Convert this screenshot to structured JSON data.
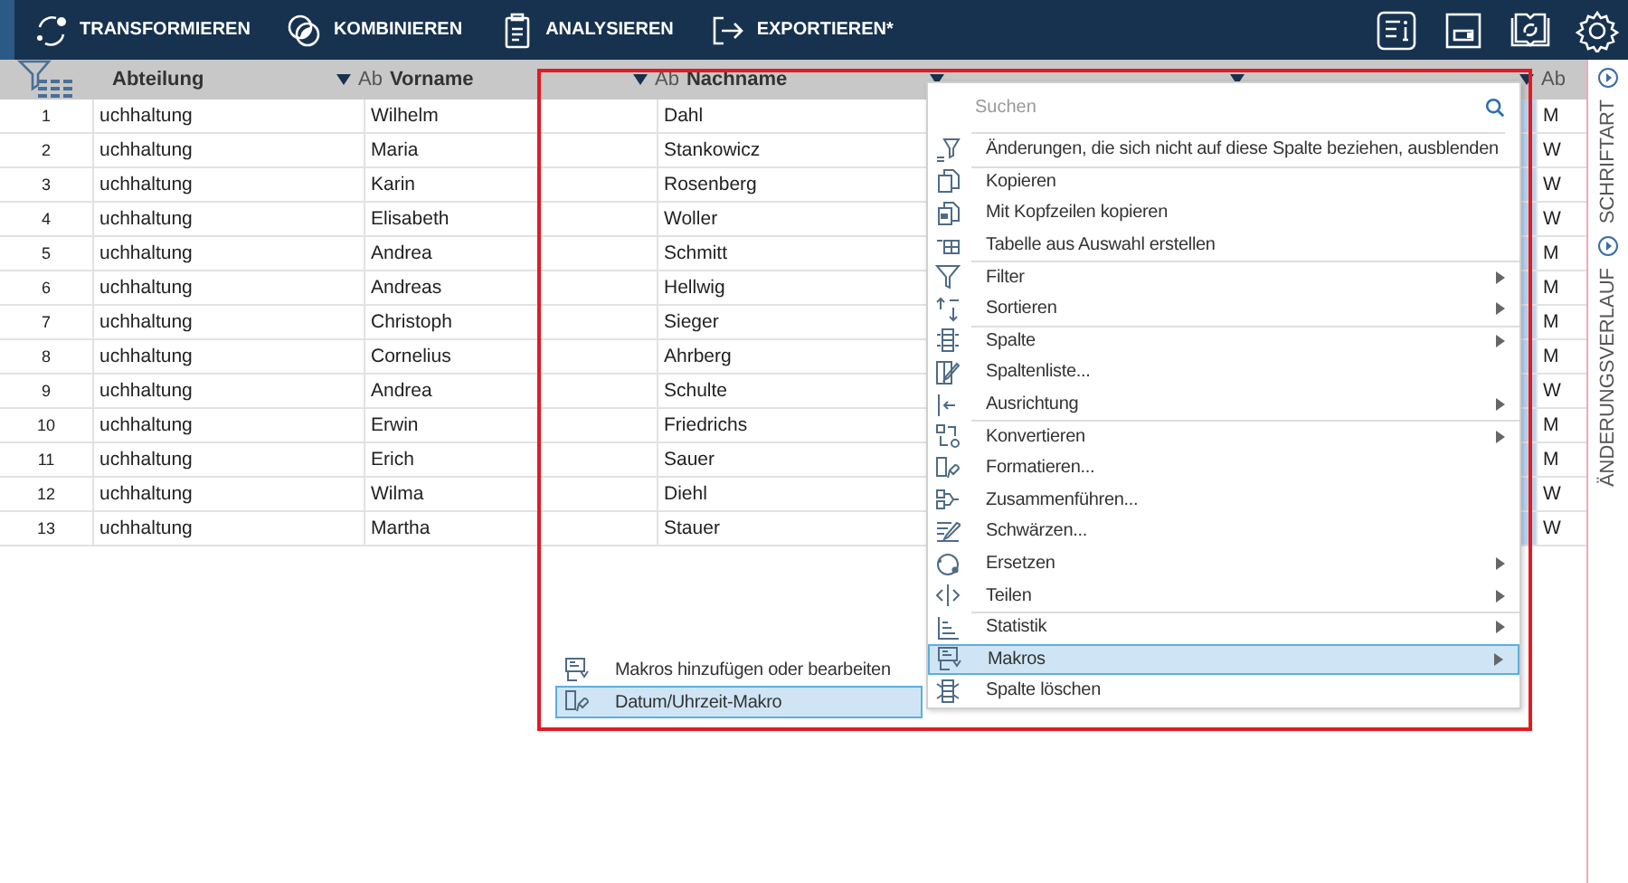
{
  "toolbar": {
    "items": [
      {
        "label": "TRANSFORMIEREN"
      },
      {
        "label": "KOMBINIEREN"
      },
      {
        "label": "ANALYSIEREN"
      },
      {
        "label": "EXPORTIEREN*"
      }
    ]
  },
  "table": {
    "columns": [
      {
        "name": "Abteilung",
        "kind": "data"
      },
      {
        "name": "Vorname",
        "type": "Ab",
        "kind": "data"
      },
      {
        "name": "Nachname",
        "type": "Ab",
        "kind": "data"
      },
      {
        "kind": "covered"
      },
      {
        "kind": "selected"
      },
      {
        "type": "Ab",
        "kind": "data"
      }
    ],
    "rows": [
      {
        "number": "1",
        "cells": [
          "uchhaltung",
          "Wilhelm",
          "Dahl",
          "M"
        ]
      },
      {
        "number": "2",
        "cells": [
          "uchhaltung",
          "Maria",
          "Stankowicz",
          "W"
        ]
      },
      {
        "number": "3",
        "cells": [
          "uchhaltung",
          "Karin",
          "Rosenberg",
          "W"
        ]
      },
      {
        "number": "4",
        "cells": [
          "uchhaltung",
          "Elisabeth",
          "Woller",
          "W"
        ]
      },
      {
        "number": "5",
        "cells": [
          "uchhaltung",
          "Andrea",
          "Schmitt",
          "M"
        ]
      },
      {
        "number": "6",
        "cells": [
          "uchhaltung",
          "Andreas",
          "Hellwig",
          "M"
        ]
      },
      {
        "number": "7",
        "cells": [
          "uchhaltung",
          "Christoph",
          "Sieger",
          "M"
        ]
      },
      {
        "number": "8",
        "cells": [
          "uchhaltung",
          "Cornelius",
          "Ahrberg",
          "M"
        ]
      },
      {
        "number": "9",
        "cells": [
          "uchhaltung",
          "Andrea",
          "Schulte",
          "W"
        ]
      },
      {
        "number": "10",
        "cells": [
          "uchhaltung",
          "Erwin",
          "Friedrichs",
          "M"
        ]
      },
      {
        "number": "11",
        "cells": [
          "uchhaltung",
          "Erich",
          "Sauer",
          "M"
        ]
      },
      {
        "number": "12",
        "cells": [
          "uchhaltung",
          "Wilma",
          "Diehl",
          "W"
        ]
      },
      {
        "number": "13",
        "cells": [
          "uchhaltung",
          "Martha",
          "Stauer",
          "W"
        ]
      }
    ]
  },
  "context_menu": {
    "search": {
      "placeholder": "Suchen"
    },
    "items": [
      {
        "label": "Änderungen, die sich nicht auf diese Spalte beziehen, ausblenden",
        "submenu": false,
        "selected": false,
        "separator_before": false
      },
      {
        "label": "Kopieren",
        "submenu": false,
        "selected": false,
        "separator_before": true
      },
      {
        "label": "Mit Kopfzeilen kopieren",
        "submenu": false,
        "selected": false,
        "separator_before": false
      },
      {
        "label": "Tabelle aus Auswahl erstellen",
        "submenu": false,
        "selected": false,
        "separator_before": false
      },
      {
        "label": "Filter",
        "submenu": true,
        "selected": false,
        "separator_before": true
      },
      {
        "label": "Sortieren",
        "submenu": true,
        "selected": false,
        "separator_before": false
      },
      {
        "label": "Spalte",
        "submenu": true,
        "selected": false,
        "separator_before": true
      },
      {
        "label": "Spaltenliste...",
        "submenu": false,
        "selected": false,
        "separator_before": false
      },
      {
        "label": "Ausrichtung",
        "submenu": true,
        "selected": false,
        "separator_before": false
      },
      {
        "label": "Konvertieren",
        "submenu": true,
        "selected": false,
        "separator_before": true
      },
      {
        "label": "Formatieren...",
        "submenu": false,
        "selected": false,
        "separator_before": false
      },
      {
        "label": "Zusammenführen...",
        "submenu": false,
        "selected": false,
        "separator_before": false
      },
      {
        "label": "Schwärzen...",
        "submenu": false,
        "selected": false,
        "separator_before": false
      },
      {
        "label": "Ersetzen",
        "submenu": true,
        "selected": false,
        "separator_before": false
      },
      {
        "label": "Teilen",
        "submenu": true,
        "selected": false,
        "separator_before": false
      },
      {
        "label": "Statistik",
        "submenu": true,
        "selected": false,
        "separator_before": true
      },
      {
        "label": "Makros",
        "submenu": true,
        "selected": true,
        "separator_before": false
      },
      {
        "label": "Spalte löschen",
        "submenu": false,
        "selected": false,
        "separator_before": false
      }
    ]
  },
  "submenu": {
    "items": [
      {
        "label": "Makros hinzufügen oder bearbeiten",
        "selected": false
      },
      {
        "label": "Datum/Uhrzeit-Makro",
        "selected": true
      }
    ]
  },
  "side_panel": {
    "tabs": [
      {
        "label": "SCHRIFTART"
      },
      {
        "label": "ÄNDERUNGSVERLAUF"
      }
    ]
  }
}
